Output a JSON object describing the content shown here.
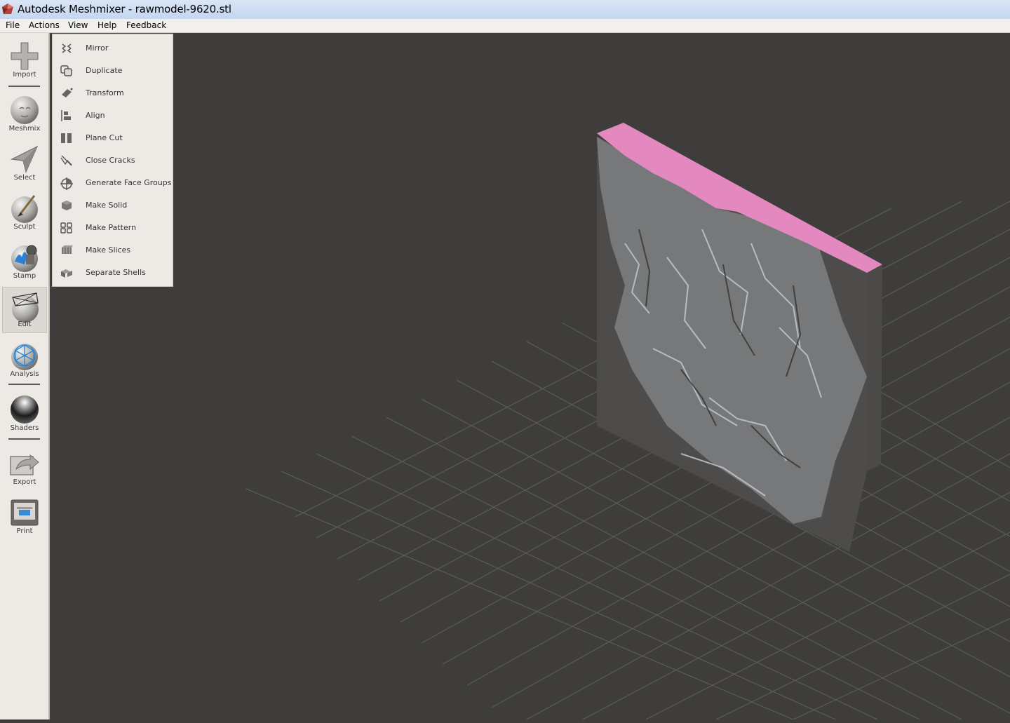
{
  "window": {
    "title": "Autodesk Meshmixer - rawmodel-9620.stl"
  },
  "menubar": [
    "File",
    "Actions",
    "View",
    "Help",
    "Feedback"
  ],
  "toolbar": {
    "tools": [
      {
        "label": "Import",
        "icon": "plus-icon"
      },
      {
        "label": "Meshmix",
        "icon": "bunny-sphere-icon"
      },
      {
        "label": "Select",
        "icon": "cursor-arrow-icon"
      },
      {
        "label": "Sculpt",
        "icon": "brush-sphere-icon"
      },
      {
        "label": "Stamp",
        "icon": "stamp-sphere-icon"
      },
      {
        "label": "Edit",
        "icon": "edit-sphere-icon",
        "active": true
      },
      {
        "label": "Analysis",
        "icon": "mesh-sphere-icon"
      },
      {
        "label": "Shaders",
        "icon": "shader-sphere-icon"
      },
      {
        "label": "Export",
        "icon": "export-icon"
      },
      {
        "label": "Print",
        "icon": "printer-icon"
      }
    ]
  },
  "edit_menu": {
    "items": [
      {
        "label": "Mirror",
        "icon": "mirror-icon"
      },
      {
        "label": "Duplicate",
        "icon": "duplicate-icon"
      },
      {
        "label": "Transform",
        "icon": "transform-icon"
      },
      {
        "label": "Align",
        "icon": "align-icon"
      },
      {
        "label": "Plane Cut",
        "icon": "plane-cut-icon"
      },
      {
        "label": "Close Cracks",
        "icon": "close-cracks-icon"
      },
      {
        "label": "Generate Face Groups",
        "icon": "face-groups-icon"
      },
      {
        "label": "Make Solid",
        "icon": "make-solid-icon"
      },
      {
        "label": "Make Pattern",
        "icon": "pattern-icon"
      },
      {
        "label": "Make Slices",
        "icon": "slices-icon"
      },
      {
        "label": "Separate Shells",
        "icon": "separate-shells-icon"
      }
    ]
  },
  "colors": {
    "viewport_bg": "#3e3d3b",
    "model_top_face": "#e389c0",
    "grid_lines": "#6a6966"
  }
}
